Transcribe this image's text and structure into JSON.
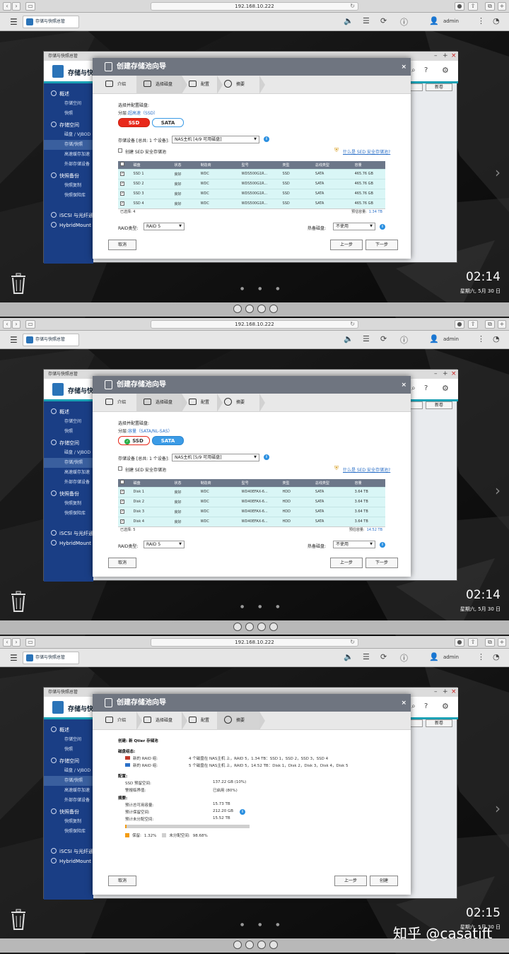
{
  "browser": {
    "url": "192.168.10.222"
  },
  "qts": {
    "app_tab_label": "存储与快照总管",
    "user": "admin"
  },
  "storage_manager": {
    "window_title": "存储与快照总管",
    "app_name": "存储与快照总管",
    "new_volume_label": "新卷",
    "sidebar": [
      {
        "label": "概述",
        "type": "head"
      },
      {
        "label": "存储空间",
        "type": "item"
      },
      {
        "label": "快照",
        "type": "item"
      },
      {
        "label": "存储空间",
        "type": "head"
      },
      {
        "label": "磁盘 / VJBOD",
        "type": "item"
      },
      {
        "label": "存储/快照",
        "type": "item",
        "selected": true
      },
      {
        "label": "高速缓存加速",
        "type": "item"
      },
      {
        "label": "外部存储设备",
        "type": "item"
      },
      {
        "label": "快照备份",
        "type": "head"
      },
      {
        "label": "快照复制",
        "type": "item"
      },
      {
        "label": "快照保险库",
        "type": "item"
      },
      {
        "label": "iSCSI 与光纤通道",
        "type": "head"
      },
      {
        "label": "HybridMount",
        "type": "head"
      }
    ]
  },
  "wizard": {
    "title": "创建存储池向导",
    "steps": [
      "介绍",
      "选择磁盘",
      "配置",
      "摘要"
    ]
  },
  "panels": [
    {
      "active_step": 1,
      "select_title": "选择并配置磁盘:",
      "tier_label": "分层:",
      "tier_value": "超高速（SSD）",
      "tier_ssd": "SSD",
      "tier_sata": "SATA",
      "tier_selected": "ssd",
      "enclosure_label": "存储设备 [总共: 1 个设备]:",
      "enclosure_value": "NAS主机 [4/9 可用磁盘]",
      "sed_label": "创建 SED 安全存储池",
      "sed_link": "什么是 SED 安全存储池?",
      "columns": [
        "磁盘",
        "状态",
        "制造商",
        "型号",
        "类型",
        "总线类型",
        "容量"
      ],
      "rows": [
        [
          "SSD 1",
          "良好",
          "WDC",
          "WDS500G1R...",
          "SSD",
          "SATA",
          "465.76 GB"
        ],
        [
          "SSD 2",
          "良好",
          "WDC",
          "WDS500G1R...",
          "SSD",
          "SATA",
          "465.76 GB"
        ],
        [
          "SSD 3",
          "良好",
          "WDC",
          "WDS500G1R...",
          "SSD",
          "SATA",
          "465.76 GB"
        ],
        [
          "SSD 4",
          "良好",
          "WDC",
          "WDS500G1R...",
          "SSD",
          "SATA",
          "465.76 GB"
        ]
      ],
      "selected_count": "已选择: 4",
      "estimated": "预估容量:",
      "estimated_value": "1.34 TB",
      "raid_label": "RAID类型:",
      "raid_value": "RAID 5",
      "hotspare_label": "热备磁盘:",
      "hotspare_value": "不使用",
      "cancel": "取消",
      "back": "上一步",
      "next": "下一步",
      "clock": "02:14",
      "date": "星期六, 5月 30 日"
    },
    {
      "active_step": 1,
      "select_title": "选择并配置磁盘:",
      "tier_label": "分层:",
      "tier_value": "容量（SATA/NL-SAS）",
      "tier_ssd": "SSD",
      "tier_sata": "SATA",
      "tier_selected": "sata",
      "enclosure_label": "存储设备 [总共: 1 个设备]:",
      "enclosure_value": "NAS主机 [5/9 可用磁盘]",
      "sed_label": "创建 SED 安全存储池",
      "sed_link": "什么是 SED 安全存储池?",
      "columns": [
        "磁盘",
        "状态",
        "制造商",
        "型号",
        "类型",
        "总线类型",
        "容量"
      ],
      "rows": [
        [
          "Disk 1",
          "良好",
          "WDC",
          "WD40EFAX-6...",
          "HDD",
          "SATA",
          "3.64 TB"
        ],
        [
          "Disk 2",
          "良好",
          "WDC",
          "WD40EFAX-6...",
          "HDD",
          "SATA",
          "3.64 TB"
        ],
        [
          "Disk 3",
          "良好",
          "WDC",
          "WD40EFAX-6...",
          "HDD",
          "SATA",
          "3.64 TB"
        ],
        [
          "Disk 4",
          "良好",
          "WDC",
          "WD40EFAX-6...",
          "HDD",
          "SATA",
          "3.64 TB"
        ]
      ],
      "selected_count": "已选择: 5",
      "estimated": "预估容量:",
      "estimated_value": "14.52 TB",
      "raid_label": "RAID类型:",
      "raid_value": "RAID 5",
      "hotspare_label": "热备磁盘:",
      "hotspare_value": "不使用",
      "cancel": "取消",
      "back": "上一步",
      "next": "下一步",
      "clock": "02:14",
      "date": "星期六, 5月 30 日"
    },
    {
      "active_step": 3,
      "create_line": "创建:  新 Qtier 存储池",
      "disk_config_label": "磁盘组态:",
      "raid_groups": [
        {
          "label": "新的 RAID 组:",
          "detail": "4 个磁盘在 NAS主机 上，RAID 5，1.34 TB：SSD 1，SSD 2，SSD 3，SSD 4",
          "color": "#c0392b"
        },
        {
          "label": "新的 RAID 组:",
          "detail": "5 个磁盘在 NAS主机 上，RAID 5，14.52 TB：Disk 1，Disk 2，Disk 3，Disk 4，Disk 5",
          "color": "#2a6fc7"
        }
      ],
      "config_label": "配置:",
      "config": [
        {
          "label": "SSD 预留空间:",
          "value": "137.22 GB (10%)"
        },
        {
          "label": "警报临界值:",
          "value": "已启用 (80%)"
        }
      ],
      "summary_label": "摘要:",
      "summary": [
        {
          "label": "预计总可用容量:",
          "value": "15.73 TB"
        },
        {
          "label": "预计保留空间:",
          "value": "212.20 GB"
        },
        {
          "label": "预计未分配空间:",
          "value": "15.52 TB"
        }
      ],
      "reserved_fraction": 0.0132,
      "legend_reserved": "保留:",
      "legend_reserved_pct": "1.32%",
      "legend_unalloc": "未分配空间:",
      "legend_unalloc_pct": "98.68%",
      "cancel": "取消",
      "back": "上一步",
      "create": "创建",
      "clock": "02:15",
      "date": "星期六, 5月 30 日"
    }
  ],
  "watermark": "知乎 @casatift",
  "colors": {
    "ssd_red": "#e8281a",
    "sata_blue": "#3b9be6",
    "sidebar": "#1a3e85",
    "accent": "#1aa1b5"
  }
}
